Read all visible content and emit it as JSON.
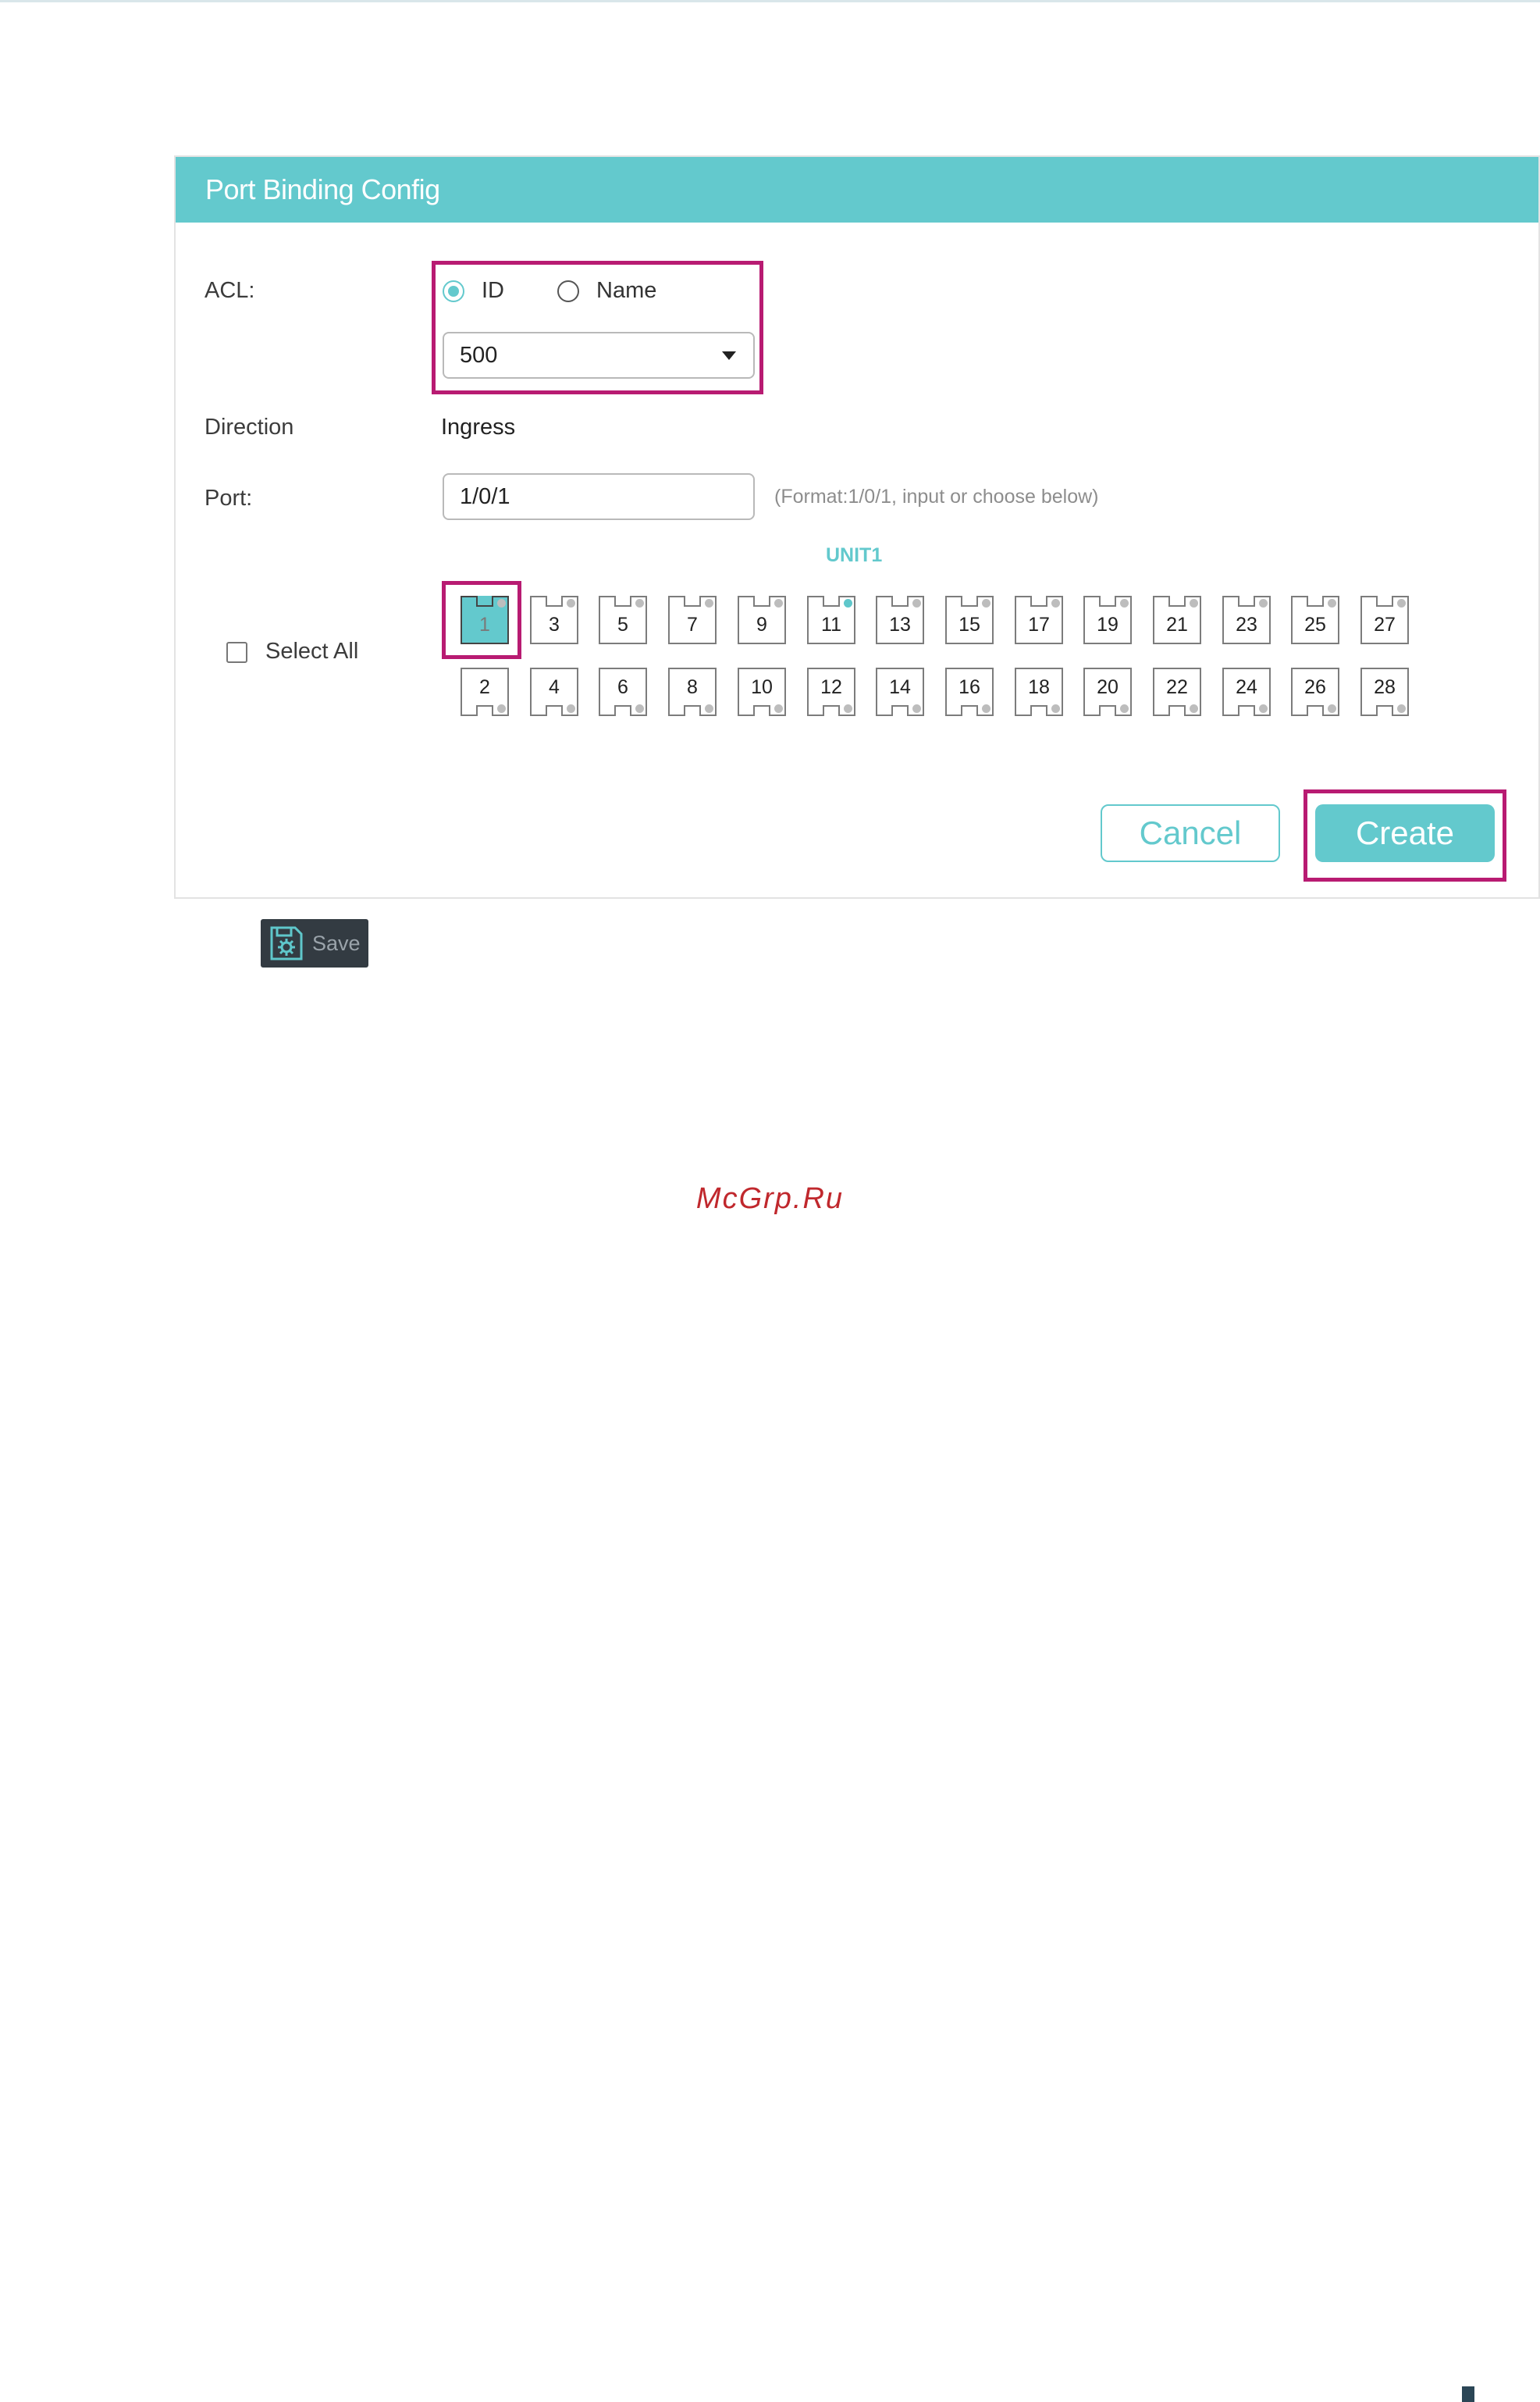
{
  "dialog": {
    "title": "Port Binding Config",
    "acl_label": "ACL:",
    "acl_mode_options": [
      {
        "label": "ID",
        "checked": true
      },
      {
        "label": "Name",
        "checked": false
      }
    ],
    "acl_selected": "500",
    "direction_label": "Direction",
    "direction_value": "Ingress",
    "port_label": "Port:",
    "port_value": "1/0/1",
    "port_hint": "(Format:1/0/1, input or choose below)",
    "unit_label": "UNIT1",
    "select_all_label": "Select All",
    "ports_top": [
      "1",
      "3",
      "5",
      "7",
      "9",
      "11",
      "13",
      "15",
      "17",
      "19",
      "21",
      "23",
      "25",
      "27"
    ],
    "ports_bottom": [
      "2",
      "4",
      "6",
      "8",
      "10",
      "12",
      "14",
      "16",
      "18",
      "20",
      "22",
      "24",
      "26",
      "28"
    ],
    "selected_port": "1",
    "active_led_port": "11",
    "cancel_label": "Cancel",
    "create_label": "Create"
  },
  "toolbar": {
    "save_label": "Save"
  },
  "watermark": "McGrp.Ru",
  "colors": {
    "accent": "#63c9cd",
    "highlight": "#b81b72",
    "watermark": "#c0282d"
  }
}
